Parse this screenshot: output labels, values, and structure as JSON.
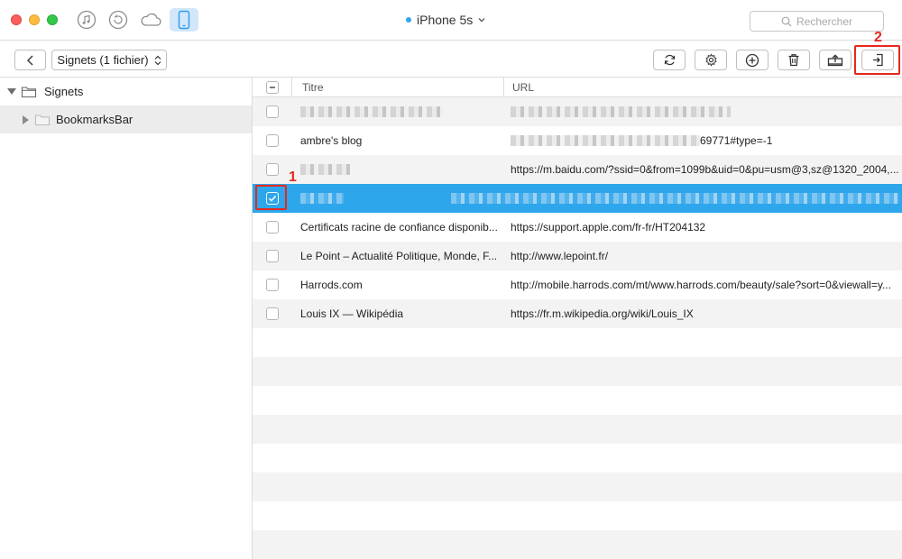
{
  "device": {
    "name": "iPhone 5s"
  },
  "search": {
    "placeholder": "Rechercher"
  },
  "toolbar": {
    "breadcrumb": "Signets (1 fichier)"
  },
  "sidebar": {
    "items": [
      {
        "label": "Signets",
        "expanded": true,
        "selected": false
      },
      {
        "label": "BookmarksBar",
        "expanded": false,
        "selected": true
      }
    ]
  },
  "table": {
    "columns": [
      "Titre",
      "URL"
    ],
    "rows": [
      {
        "title": "",
        "url": "",
        "checked": false,
        "title_obscured": true,
        "url_obscured": true
      },
      {
        "title": "ambre's blog",
        "url": "69771#type=-1",
        "checked": false,
        "title_obscured": false,
        "url_obscured": true
      },
      {
        "title": "",
        "url": "https://m.baidu.com/?ssid=0&from=1099b&uid=0&pu=usm@3,sz@1320_2004,...",
        "checked": false,
        "title_obscured": true,
        "url_obscured": false
      },
      {
        "title": "",
        "url": "",
        "checked": true,
        "selected": true,
        "title_obscured": true,
        "url_obscured": true
      },
      {
        "title": "Certificats racine de confiance disponib...",
        "url": "https://support.apple.com/fr-fr/HT204132",
        "checked": false
      },
      {
        "title": "Le Point – Actualité Politique, Monde, F...",
        "url": "http://www.lepoint.fr/",
        "checked": false
      },
      {
        "title": "Harrods.com",
        "url": "http://mobile.harrods.com/mt/www.harrods.com/beauty/sale?sort=0&viewall=y...",
        "checked": false
      },
      {
        "title": "Louis IX — Wikipédia",
        "url": "https://fr.m.wikipedia.org/wiki/Louis_IX",
        "checked": false
      }
    ]
  },
  "annotations": {
    "step1": "1",
    "step2": "2",
    "color": "#e4291c"
  },
  "colors": {
    "accent": "#2da6ec",
    "selected_sidebar": "#ececec",
    "stripe": "#f3f3f3"
  },
  "icons": [
    "music-icon",
    "restore-icon",
    "cloud-icon",
    "phone-icon",
    "search-icon",
    "back-icon",
    "sync-icon",
    "gear-icon",
    "add-icon",
    "trash-icon",
    "export-icon",
    "import-icon",
    "folder-icon"
  ]
}
